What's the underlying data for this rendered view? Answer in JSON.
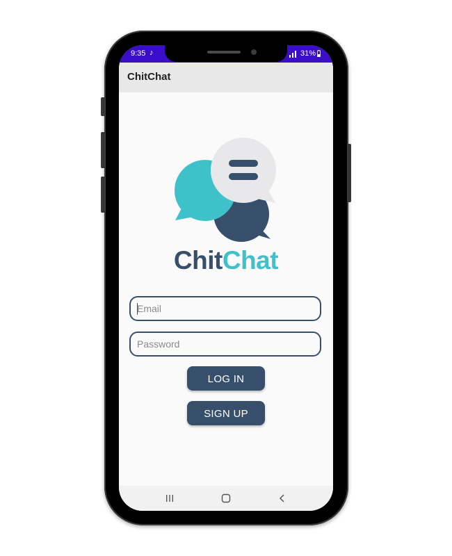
{
  "status_bar": {
    "time": "9:35",
    "music_icon": "music-note-icon",
    "signal_icon": "signal-icon",
    "battery": "31%",
    "battery_icon": "battery-icon"
  },
  "app_bar": {
    "title": "ChitChat"
  },
  "logo": {
    "word_part1": "Chit",
    "word_part2": "Chat",
    "colors": {
      "teal": "#3fc1c9",
      "navy": "#374f6b",
      "light": "#e8e8ea"
    }
  },
  "login_form": {
    "email": {
      "value": "",
      "placeholder": "Email"
    },
    "password": {
      "value": "",
      "placeholder": "Password"
    },
    "login_label": "LOG IN",
    "signup_label": "SIGN UP"
  },
  "nav_bar": {
    "recents_icon": "recents-icon",
    "home_icon": "home-icon",
    "back_icon": "back-icon"
  },
  "colors": {
    "status_bar": "#3a0ec8",
    "primary": "#374f6b",
    "accent": "#3fc1c9",
    "app_bar": "#e8e8e8",
    "background": "#fafafa"
  }
}
